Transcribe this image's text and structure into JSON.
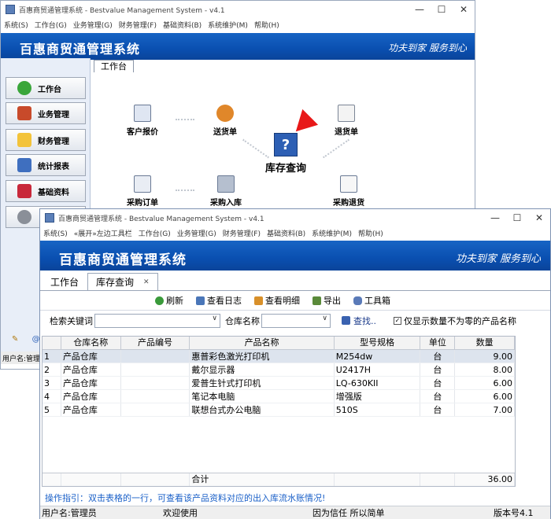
{
  "back_window": {
    "title": "百惠商贸通管理系统 - Bestvalue Management System - v4.1",
    "menu": [
      "系统(S)",
      "工作台(G)",
      "业务管理(G)",
      "财务管理(F)",
      "基础资料(B)",
      "系统维护(M)",
      "帮助(H)"
    ],
    "banner_title": "百惠商贸通管理系统",
    "banner_slogan": "功夫到家 服务到心",
    "sidebar": [
      "工作台",
      "业务管理",
      "财务管理",
      "统计报表",
      "基础资料"
    ],
    "tab": "工作台",
    "flow": {
      "quote": "客户报价",
      "delivery": "送货单",
      "return": "退货单",
      "stock_query": "库存查询",
      "purchase_order": "采购订单",
      "purchase_in": "采购入库",
      "purchase_return": "采购退货"
    },
    "status_user": "用户名:管理"
  },
  "front_window": {
    "title": "百惠商贸通管理系统 - Bestvalue Management System - v4.1",
    "menu": [
      "系统(S)",
      "«展开»左边工具栏",
      "工作台(G)",
      "业务管理(G)",
      "财务管理(F)",
      "基础资料(B)",
      "系统维护(M)",
      "帮助(H)"
    ],
    "banner_title": "百惠商贸通管理系统",
    "banner_slogan": "功夫到家 服务到心",
    "tabs": [
      "工作台",
      "库存查询"
    ],
    "toolbar": {
      "refresh": "刷新",
      "log": "查看日志",
      "detail": "查看明细",
      "export": "导出",
      "toolbox": "工具箱"
    },
    "search": {
      "keyword_label": "检索关键词",
      "warehouse_label": "仓库名称",
      "find": "查找..",
      "nonzero_label": "仅显示数量不为零的产品名称"
    },
    "table": {
      "headers": [
        "仓库名称",
        "产品编号",
        "产品名称",
        "型号规格",
        "单位",
        "数量"
      ],
      "rows": [
        {
          "n": "1",
          "wh": "产品仓库",
          "code": "",
          "name": "惠普彩色激光打印机",
          "model": "M254dw",
          "unit": "台",
          "qty": "9.00"
        },
        {
          "n": "2",
          "wh": "产品仓库",
          "code": "",
          "name": "戴尔显示器",
          "model": "U2417H",
          "unit": "台",
          "qty": "8.00"
        },
        {
          "n": "3",
          "wh": "产品仓库",
          "code": "",
          "name": "爱普生针式打印机",
          "model": "LQ-630KII",
          "unit": "台",
          "qty": "6.00"
        },
        {
          "n": "4",
          "wh": "产品仓库",
          "code": "",
          "name": "笔记本电脑",
          "model": "增强版",
          "unit": "台",
          "qty": "6.00"
        },
        {
          "n": "5",
          "wh": "产品仓库",
          "code": "",
          "name": "联想台式办公电脑",
          "model": "510S",
          "unit": "台",
          "qty": "7.00"
        }
      ],
      "total_label": "合计",
      "total_qty": "36.00"
    },
    "hint": "操作指引：双击表格的一行，可查看该产品资料对应的出入库流水账情况!",
    "status": {
      "user": "用户名:管理员",
      "welcome": "欢迎使用",
      "motto": "因为信任 所以简单",
      "version": "版本号4.1"
    }
  }
}
